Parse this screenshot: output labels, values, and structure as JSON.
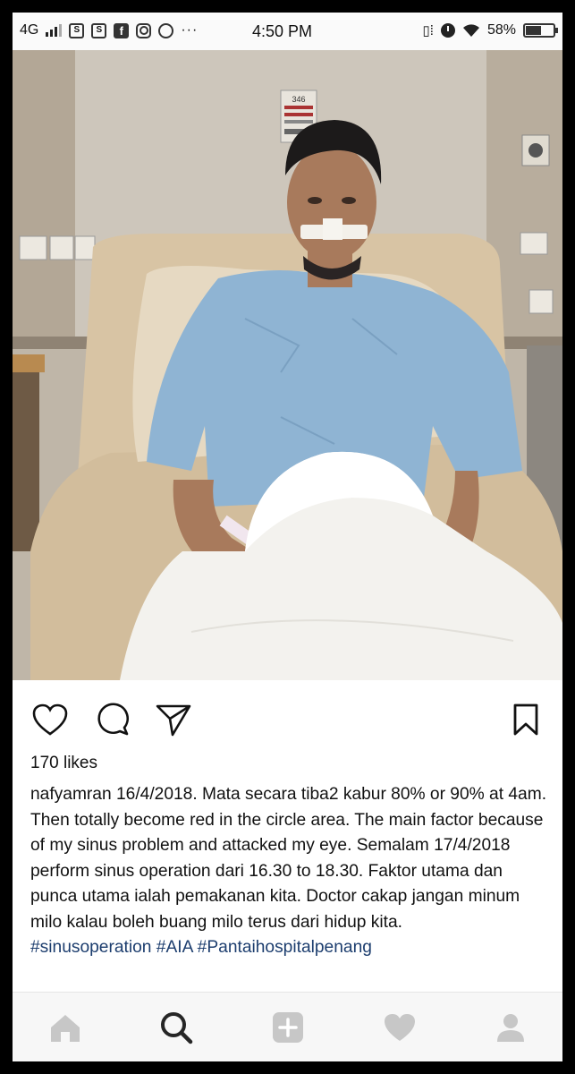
{
  "status_bar": {
    "network": "4G",
    "time": "4:50 PM",
    "battery": "58%",
    "notification_icons": [
      "s-icon",
      "s-icon",
      "facebook-icon",
      "instagram-icon",
      "chrome-icon"
    ],
    "more": "···"
  },
  "post": {
    "image_alt": "Man in hospital gown sitting in a hospital bed with a bandage across his nose",
    "room_number": "346",
    "likes": "170 likes",
    "username": "nafyamran",
    "caption_text": " 16/4/2018. Mata secara tiba2 kabur 80% or 90% at 4am. Then totally become red in the circle area. The main factor because of my sinus problem and attacked my eye. Semalam 17/4/2018 perform sinus operation dari 16.30 to 18.30. Faktor utama dan punca utama ialah pemakanan kita. Doctor cakap jangan minum milo kalau boleh buang milo terus dari hidup kita.",
    "hashtags": "#sinusoperation #AIA #Pantaihospitalpenang"
  },
  "actions": {
    "like": "heart-icon",
    "comment": "comment-icon",
    "share": "send-icon",
    "save": "bookmark-icon"
  },
  "bottom_nav": [
    "home-icon",
    "search-icon",
    "add-icon",
    "activity-icon",
    "profile-icon"
  ],
  "colors": {
    "hashtag": "#1c3d6e",
    "gown": "#8fb4d3",
    "nav_inactive": "#c7c7c7",
    "nav_active": "#262626"
  }
}
